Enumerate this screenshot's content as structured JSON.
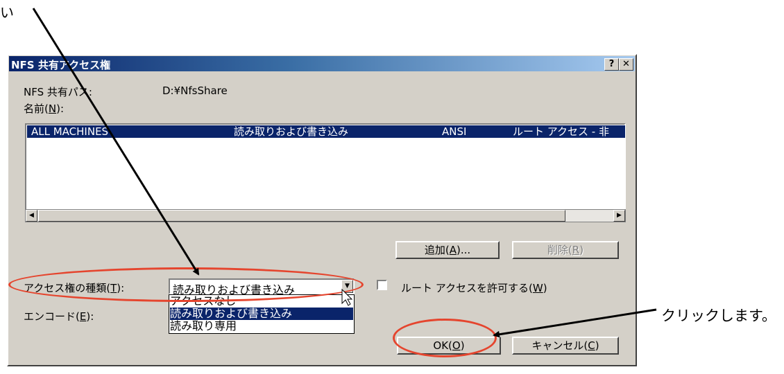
{
  "annotations": {
    "top_note": "い",
    "side_note": "クリックします。"
  },
  "dialog": {
    "title": "NFS 共有アクセス権",
    "help_button": "?",
    "close_button": "✕",
    "share_path_label": "NFS 共有パス:",
    "share_path_value": "D:¥NfsShare",
    "name_label": "名前(N):",
    "list_row": {
      "name": "ALL MACHINES",
      "access": "読み取りおよび書き込み",
      "encoding": "ANSI",
      "root": "ルート アクセス - 非"
    },
    "add_button": "追加(A)...",
    "remove_button": "削除(R)",
    "access_type_label": "アクセス権の種類(T):",
    "access_type_value": "読み取りおよび書き込み",
    "dropdown_options": [
      "アクセスなし",
      "読み取りおよび書き込み",
      "読み取り専用"
    ],
    "dropdown_selected_index": 1,
    "root_access_label": "ルート アクセスを許可する(W)",
    "root_access_checked": false,
    "encode_label": "エンコード(E):",
    "ok_button": "OK(O)",
    "cancel_button": "キャンセル(C)"
  },
  "colors": {
    "highlight": "#0a246a",
    "annotation_ellipse": "#e5452e",
    "dialog_face": "#d4d0c8"
  }
}
